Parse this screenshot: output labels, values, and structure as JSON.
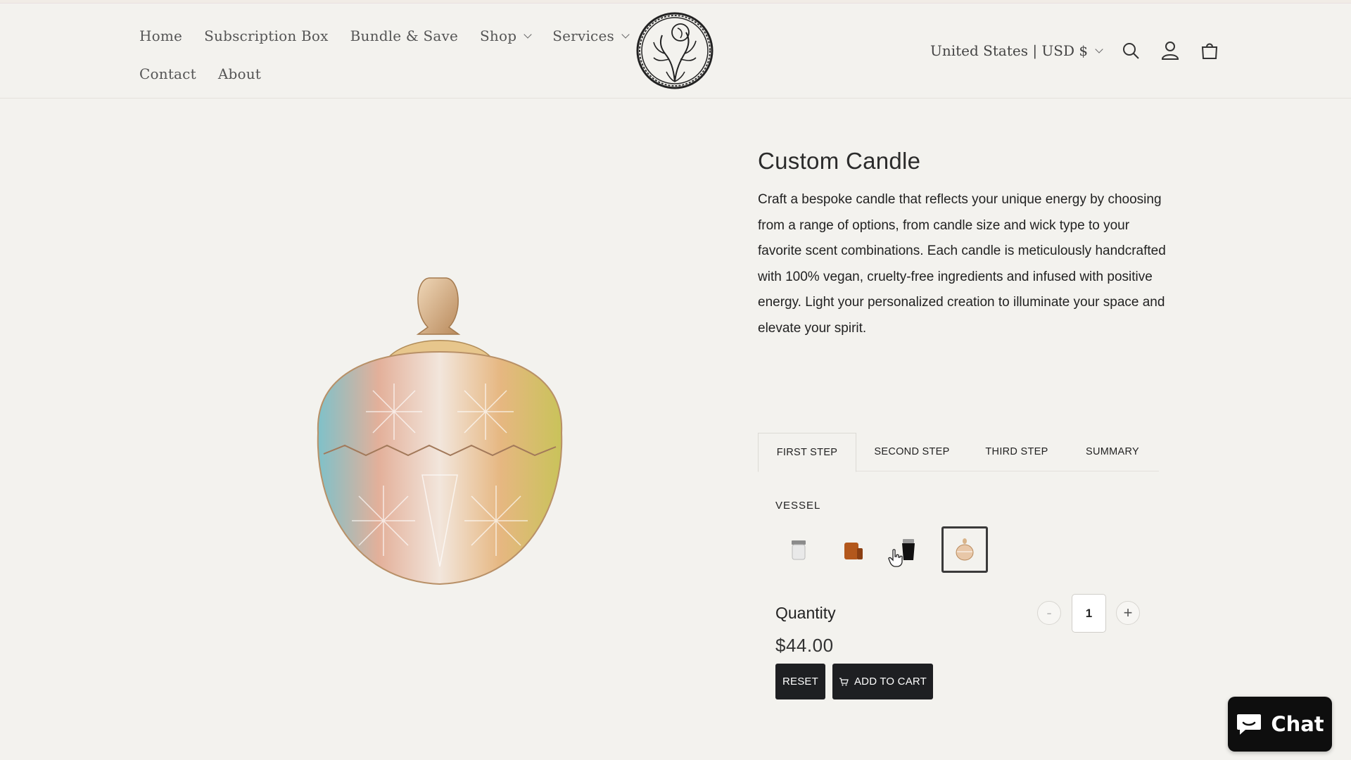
{
  "header": {
    "nav_row1": [
      {
        "label": "Home"
      },
      {
        "label": "Subscription Box"
      },
      {
        "label": "Bundle & Save"
      },
      {
        "label": "Shop"
      },
      {
        "label": "Services"
      }
    ],
    "nav_row2": [
      {
        "label": "Contact"
      },
      {
        "label": "About"
      }
    ],
    "locale": "United States | USD $",
    "icons": [
      "search-icon",
      "account-icon",
      "cart-icon"
    ]
  },
  "product": {
    "title": "Custom Candle",
    "description": "Craft a bespoke candle that reflects your unique energy by choosing from a range of options, from candle size and wick type to your favorite scent combinations. Each candle is meticulously handcrafted with 100% vegan, cruelty-free ingredients and infused with positive energy. Light your personalized creation to illuminate your space and elevate your spirit."
  },
  "builder": {
    "tabs": [
      "FIRST STEP",
      "SECOND STEP",
      "THIRD STEP",
      "SUMMARY"
    ],
    "active_tab": "FIRST STEP",
    "vessel_label": "VESSEL",
    "vessel_options": [
      "clear-glass-jar",
      "amber-glass-jar",
      "black-tumbler",
      "crystal-candy-dish"
    ],
    "selected_vessel": "crystal-candy-dish",
    "quantity_label": "Quantity",
    "quantity": "1",
    "minus": "-",
    "plus": "+",
    "price": "$44.00",
    "reset_label": "RESET",
    "add_to_cart_label": "ADD TO CART"
  },
  "chat": {
    "label": "Chat",
    "color": "#0e0e0e"
  }
}
